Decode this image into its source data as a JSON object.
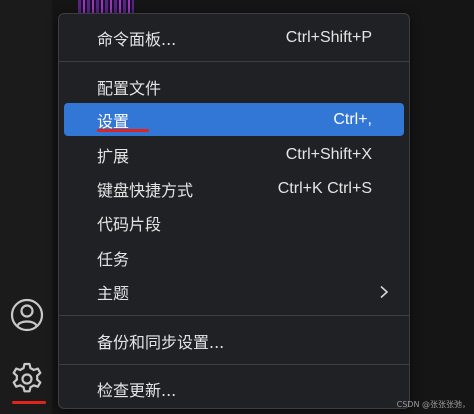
{
  "menu": {
    "items": [
      {
        "label": "命令面板...",
        "shortcut": "Ctrl+Shift+P"
      },
      {
        "label": "配置文件",
        "shortcut": ""
      },
      {
        "label": "设置",
        "shortcut": "Ctrl+,"
      },
      {
        "label": "扩展",
        "shortcut": "Ctrl+Shift+X"
      },
      {
        "label": "键盘快捷方式",
        "shortcut": "Ctrl+K Ctrl+S"
      },
      {
        "label": "代码片段",
        "shortcut": ""
      },
      {
        "label": "任务",
        "shortcut": ""
      },
      {
        "label": "主题",
        "shortcut": ""
      },
      {
        "label": "备份和同步设置...",
        "shortcut": ""
      },
      {
        "label": "检查更新...",
        "shortcut": ""
      }
    ],
    "active_item": "设置",
    "highlight_color": "#3377d6"
  },
  "icons": {
    "account": "account-icon",
    "gear": "gear-icon",
    "submenu": "chevron-right-icon"
  },
  "annotation_color": "#e0241c",
  "watermark": "CSDN @张张张弛，"
}
